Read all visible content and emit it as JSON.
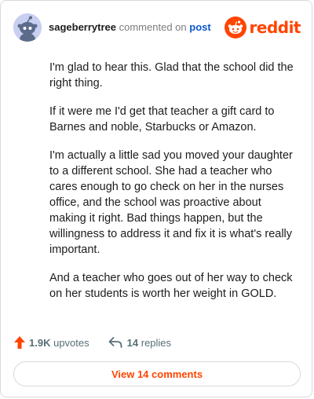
{
  "header": {
    "username": "sageberrytree",
    "action_text": "commented on",
    "post_link": "post",
    "brand": "reddit",
    "brand_color": "#ff4500",
    "avatar_icon": "snoo-avatar-icon"
  },
  "comment": {
    "paragraphs": [
      "I'm glad to hear this. Glad that the school did the right thing.",
      "If it were me I'd get that teacher a gift card to Barnes and noble, Starbucks or Amazon.",
      "I'm actually a little sad you moved your daughter to a different school. She had a teacher who cares enough to go check on her in the nurses office, and the school was proactive about making it right. Bad things happen, but the willingness to address it and fix it is what's really important.",
      "And a teacher who goes out of her way to check on her students is worth her weight in GOLD."
    ]
  },
  "actions": {
    "upvotes_count": "1.9K",
    "upvotes_label": "upvotes",
    "replies_count": "14",
    "replies_label": "replies",
    "upvote_icon": "upvote-arrow-icon",
    "reply_icon": "reply-arrow-icon",
    "upvote_color": "#ff4500"
  },
  "footer": {
    "view_comments_label": "View 14 comments"
  }
}
